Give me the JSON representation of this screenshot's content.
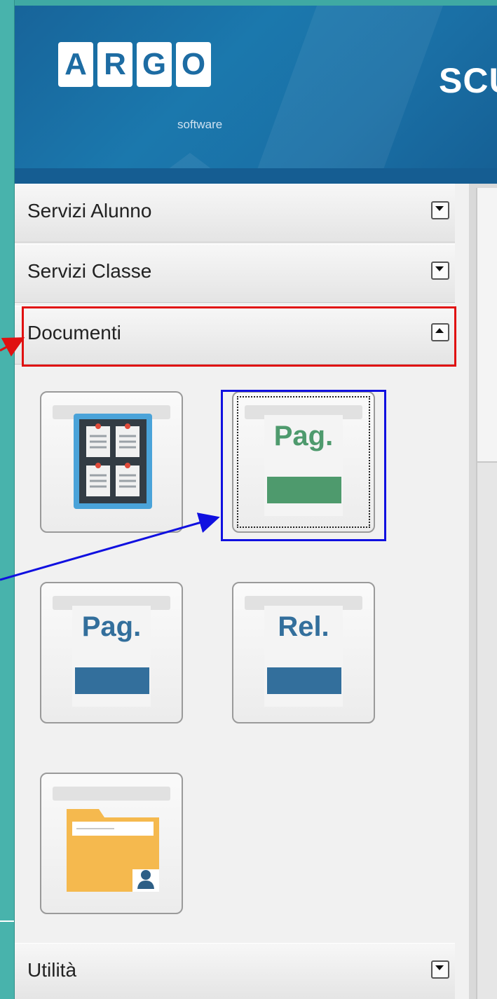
{
  "header": {
    "logo_letters": [
      "A",
      "R",
      "G",
      "O"
    ],
    "logo_sub": "software",
    "brand_partial": "SCU"
  },
  "sidebar": {
    "sections": [
      {
        "label": "Servizi Alunno",
        "state": "collapsed"
      },
      {
        "label": "Servizi Classe",
        "state": "collapsed"
      },
      {
        "label": "Documenti",
        "state": "expanded"
      },
      {
        "label": "Utilità",
        "state": "collapsed"
      }
    ],
    "document_tiles": [
      {
        "icon": "bulletin-board-icon",
        "text": ""
      },
      {
        "icon": "pag-green-icon",
        "text": "Pag.",
        "color": "#4e9a6d",
        "selected": true
      },
      {
        "icon": "pag-blue-icon",
        "text": "Pag.",
        "color": "#336f9c"
      },
      {
        "icon": "rel-blue-icon",
        "text": "Rel.",
        "color": "#336f9c"
      },
      {
        "icon": "student-folder-icon",
        "text": ""
      }
    ]
  },
  "colors": {
    "background": "#48b3ac",
    "header_blue": "#1b78ad",
    "annotation_red": "#e01010",
    "annotation_blue": "#1010e0",
    "tile_green": "#4e9a6d",
    "tile_blue": "#336f9c"
  }
}
